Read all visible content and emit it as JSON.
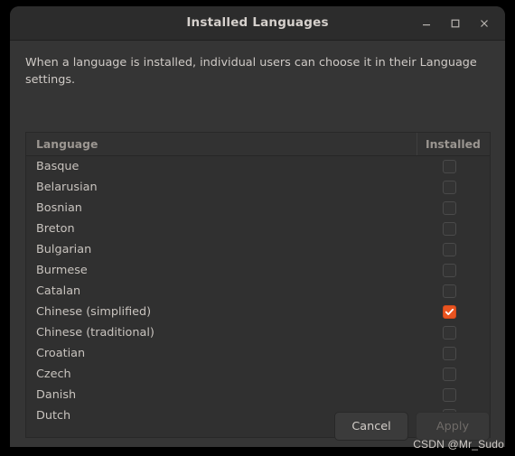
{
  "window": {
    "title": "Installed Languages",
    "controls": [
      {
        "name": "minimize",
        "glyph": "minimize-icon"
      },
      {
        "name": "maximize",
        "glyph": "maximize-icon"
      },
      {
        "name": "close",
        "glyph": "close-icon"
      }
    ]
  },
  "description": "When a language is installed, individual users can choose it in their Language settings.",
  "table": {
    "columns": [
      "Language",
      "Installed"
    ],
    "rows": [
      {
        "language": "Basque",
        "installed": false
      },
      {
        "language": "Belarusian",
        "installed": false
      },
      {
        "language": "Bosnian",
        "installed": false
      },
      {
        "language": "Breton",
        "installed": false
      },
      {
        "language": "Bulgarian",
        "installed": false
      },
      {
        "language": "Burmese",
        "installed": false
      },
      {
        "language": "Catalan",
        "installed": false
      },
      {
        "language": "Chinese (simplified)",
        "installed": true
      },
      {
        "language": "Chinese (traditional)",
        "installed": false
      },
      {
        "language": "Croatian",
        "installed": false
      },
      {
        "language": "Czech",
        "installed": false
      },
      {
        "language": "Danish",
        "installed": false
      },
      {
        "language": "Dutch",
        "installed": false
      },
      {
        "language": "",
        "installed": false
      }
    ]
  },
  "footer": {
    "cancel_label": "Cancel",
    "apply_label": "Apply",
    "apply_disabled": true
  },
  "watermark": "CSDN @Mr_Sudo",
  "colors": {
    "accent": "#e95420",
    "window_bg": "#353535",
    "titlebar_bg": "#2c2c2c",
    "list_bg": "#303030",
    "text": "#c9c4bf",
    "header_text": "#9b9691",
    "disabled_text": "#6f6b68"
  }
}
